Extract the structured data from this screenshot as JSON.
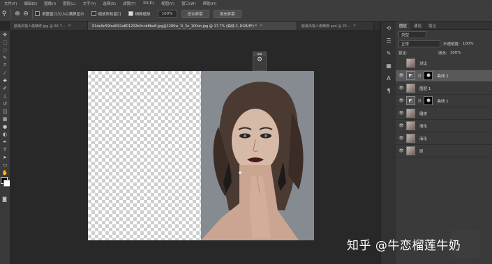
{
  "menubar": {
    "items": [
      "文件(F)",
      "编辑(E)",
      "图像(I)",
      "图层(L)",
      "文字(Y)",
      "选择(S)",
      "滤镜(T)",
      "3D(D)",
      "视图(V)",
      "窗口(W)",
      "帮助(H)"
    ]
  },
  "options": {
    "resize_windows_label": "调整窗口大小以满屏显示",
    "zoom_all_label": "缩放所有窗口",
    "scrubby_zoom_label": "细微缩放",
    "zoom_value": "100%",
    "fit_screen_label": "适合屏幕",
    "fill_screen_label": "填充屏幕"
  },
  "tabs": [
    {
      "label": "欧美风格人像精修.jpg @ 66.7...",
      "close": "×"
    },
    {
      "label": "01de9c59fad092a801202b0ccb8be8.jpg@1280w_1l_2o_100sh.jpg @ 17.7% (曲线 2, RGB/8*) *",
      "close": "×"
    },
    {
      "label": "欧美风格人像精修.psd @ 25...",
      "close": "×"
    }
  ],
  "layers_panel": {
    "tabs": [
      "图层",
      "通道",
      "路径"
    ],
    "kind_filter": "类型",
    "blend_mode": "正常",
    "opacity_label": "不透明度:",
    "opacity_value": "100%",
    "lock_label": "锁定:",
    "fill_label": "填充:",
    "fill_value": "100%",
    "layers": [
      {
        "name": "对比",
        "visible": false,
        "type": "pixel",
        "selected": false
      },
      {
        "name": "曲线 2",
        "visible": true,
        "type": "adjustment",
        "selected": true
      },
      {
        "name": "图层 1",
        "visible": true,
        "type": "pixel",
        "selected": false
      },
      {
        "name": "曲线 1",
        "visible": true,
        "type": "adjustment",
        "selected": false
      },
      {
        "name": "磨皮",
        "visible": true,
        "type": "pixel",
        "selected": false
      },
      {
        "name": "液化",
        "visible": true,
        "type": "pixel",
        "selected": false
      },
      {
        "name": "液化",
        "visible": true,
        "type": "pixel",
        "selected": false
      },
      {
        "name": "原",
        "visible": true,
        "type": "pixel",
        "selected": false
      }
    ]
  },
  "watermark": {
    "text": "知乎 @牛恋榴莲牛奶"
  },
  "colors": {
    "foreground": "#000000",
    "background": "#ffffff"
  },
  "icons": {
    "eye": "eye-icon",
    "adjustment": "curves-adjustment-icon",
    "zoom_in": "zoom-in-icon",
    "zoom_out": "zoom-out-icon"
  }
}
